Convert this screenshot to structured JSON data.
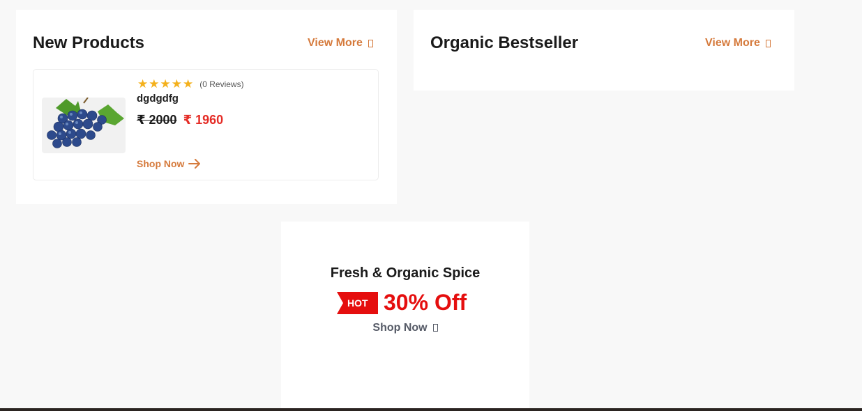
{
  "new_products": {
    "title": "New Products",
    "view_more": "View More",
    "product": {
      "rating_stars": 5,
      "reviews": "(0 Reviews)",
      "name": "dgdgdfg",
      "old_price": "₹ 2000",
      "new_price": "₹ 1960",
      "shop_now": "Shop Now",
      "image_icon": "grapes-image"
    }
  },
  "bestseller": {
    "title": "Organic Bestseller",
    "view_more": "View More"
  },
  "promo": {
    "title": "Fresh & Organic Spice",
    "tag": "HOT",
    "offer": "30% Off",
    "shop_now": "Shop Now"
  },
  "colors": {
    "accent": "#d57a3c",
    "price_red": "#e52d27",
    "offer_red": "#e50e0e",
    "star": "#f4b01b"
  }
}
